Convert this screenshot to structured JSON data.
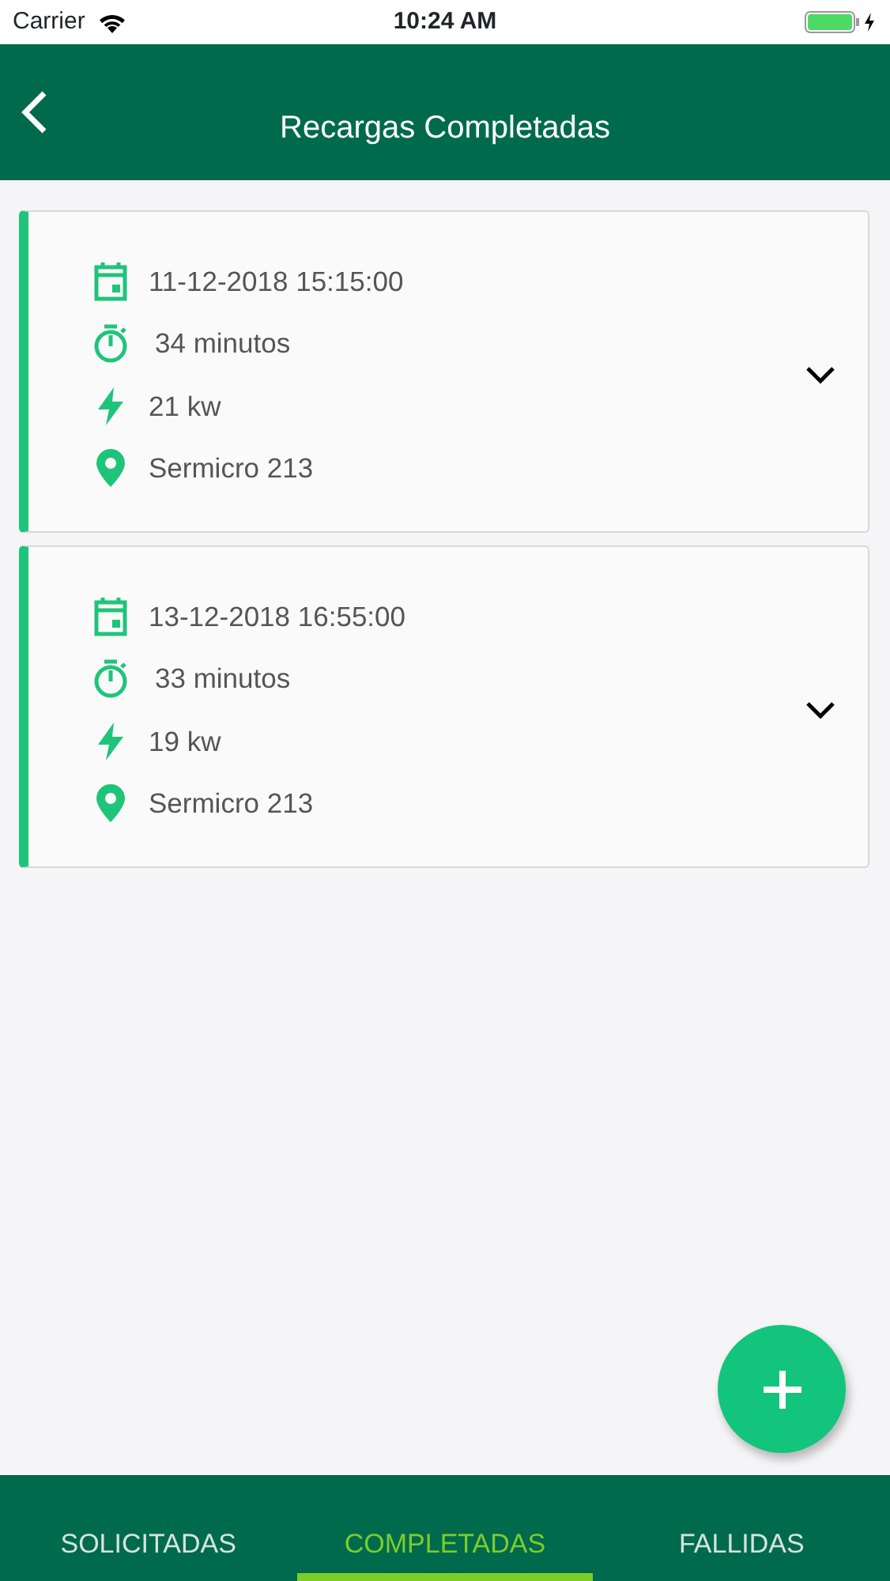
{
  "status_bar": {
    "carrier": "Carrier",
    "time": "10:24 AM"
  },
  "header": {
    "title": "Recargas Completadas"
  },
  "recharges": [
    {
      "date": "11-12-2018 15:15:00",
      "duration": "34 minutos",
      "power": "21 kw",
      "location": "Sermicro 213",
      "expanded": false
    },
    {
      "date": "13-12-2018 16:55:00",
      "duration": "33 minutos",
      "power": "19 kw",
      "location": "Sermicro 213",
      "expanded": false
    }
  ],
  "tabs": [
    {
      "label": "SOLICITADAS",
      "selected": false
    },
    {
      "label": "COMPLETADAS",
      "selected": true
    },
    {
      "label": "FALLIDAS",
      "selected": false
    }
  ]
}
